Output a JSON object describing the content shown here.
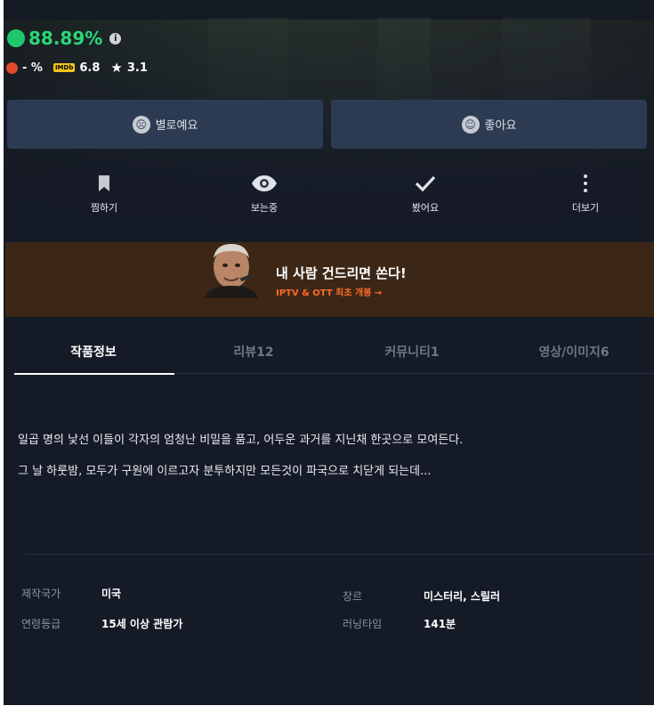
{
  "ratings": {
    "score": "88.89%",
    "info_glyph": "i",
    "rotten": "- %",
    "imdb_badge": "IMDb",
    "imdb": "6.8",
    "star": "3.1"
  },
  "reactions": {
    "dislike": "별로예요",
    "like": "좋아요"
  },
  "actions": [
    "찜하기",
    "보는중",
    "봤어요",
    "더보기"
  ],
  "banner": {
    "title": "내 사람 건드리면 쏜다!",
    "subtitle": "IPTV & OTT 최초 개봉 →"
  },
  "tabs": [
    "작품정보",
    "리뷰12",
    "커뮤니티1",
    "영상/이미지6"
  ],
  "description": {
    "line1": "일곱 명의 낯선 이들이 각자의 엄청난 비밀을 품고, 어두운 과거를 지닌채 한곳으로 모여든다.",
    "line2": "그 날 하룻밤, 모두가 구원에 이르고자 분투하지만 모든것이 파국으로 치닫게 되는데..."
  },
  "meta": {
    "country_label": "제작국가",
    "country": "미국",
    "genre_label": "장르",
    "genre": "미스터리,  스릴러",
    "age_label": "연령등급",
    "age": "15세 이상 관람가",
    "runtime_label": "러닝타임",
    "runtime": "141분"
  },
  "colors": {
    "background": "#151a27",
    "button": "#2d3b52",
    "score_green": "#2cd67a",
    "banner_bg": "#3c2716",
    "banner_accent": "#ff6a2a"
  }
}
